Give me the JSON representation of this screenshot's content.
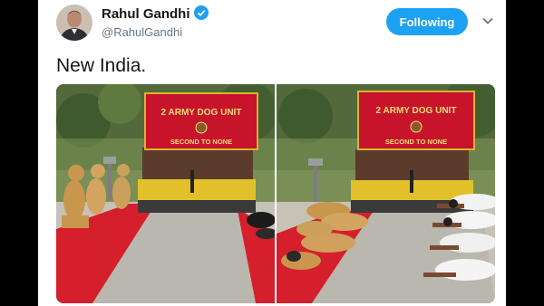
{
  "author": {
    "name": "Rahul Gandhi",
    "handle": "@RahulGandhi",
    "verified": true,
    "avatar_icon": "profile-photo"
  },
  "actions": {
    "follow_label": "Following",
    "menu_icon": "chevron-down-icon"
  },
  "tweet": {
    "text": "New India."
  },
  "media": {
    "images": [
      {
        "sign_line1": "2 ARMY DOG UNIT",
        "sign_line2": "SECOND TO NONE",
        "subject": "army-dogs-yoga-pose"
      },
      {
        "sign_line1": "2 ARMY DOG UNIT",
        "sign_line2": "SECOND TO NONE",
        "subject": "dogs-and-soldiers-yoga-pose"
      }
    ]
  },
  "colors": {
    "follow_button": "#1da1f2",
    "verified_badge": "#1da1f2",
    "sign_red": "#c8142b",
    "carpet_red": "#d51f2c"
  }
}
